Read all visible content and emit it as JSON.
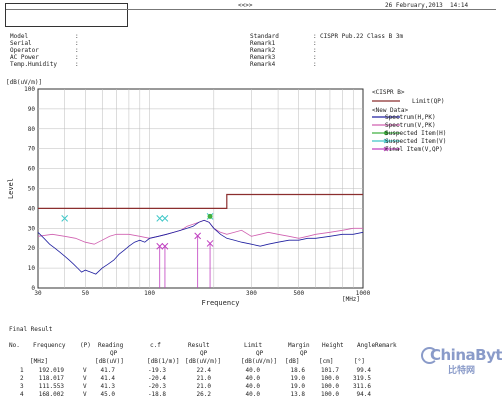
{
  "header": {
    "nav": "<<>>",
    "date": "26 February,2013  14:14",
    "left_fields": [
      {
        "label": "Model",
        "sep": ":",
        "value": ""
      },
      {
        "label": "Serial",
        "sep": ":",
        "value": ""
      },
      {
        "label": "Operator",
        "sep": ":",
        "value": ""
      },
      {
        "label": "AC Power",
        "sep": ":",
        "value": ""
      },
      {
        "label": "Temp.Humidity",
        "sep": ":",
        "value": ""
      }
    ],
    "right_fields": [
      {
        "label": "Standard",
        "sep": ":",
        "value": "CISPR Pub.22 Class B 3m"
      },
      {
        "label": "Remark1",
        "sep": ":",
        "value": ""
      },
      {
        "label": "Remark2",
        "sep": ":",
        "value": ""
      },
      {
        "label": "Remark3",
        "sep": ":",
        "value": ""
      },
      {
        "label": "Remark4",
        "sep": ":",
        "value": ""
      }
    ]
  },
  "chart_data": {
    "type": "line",
    "ylabel_unit": "[dB(uV/m)]",
    "ylabel": "Level",
    "xlabel": "Frequency",
    "xunit": "[MHz]",
    "xscale": "log",
    "xlim": [
      30,
      1000
    ],
    "ylim": [
      0,
      100
    ],
    "yticks": [
      0,
      10,
      20,
      30,
      40,
      50,
      60,
      70,
      80,
      90,
      100
    ],
    "xticks": [
      {
        "value": 30,
        "label": "30"
      },
      {
        "value": 50,
        "label": "50"
      },
      {
        "value": 100,
        "label": "100"
      },
      {
        "value": 300,
        "label": "300"
      },
      {
        "value": 500,
        "label": "500"
      },
      {
        "value": 1000,
        "label": "1000"
      }
    ],
    "grid": true,
    "limit_line": {
      "x": [
        30,
        230,
        230,
        1000
      ],
      "y": [
        40,
        40,
        47,
        47
      ],
      "color": "#8b2e2e"
    },
    "spectrum_h": {
      "color": "#2020a0",
      "x": [
        30,
        32,
        34,
        36,
        38,
        40,
        42,
        44,
        46,
        48,
        50,
        53,
        56,
        60,
        64,
        68,
        72,
        76,
        80,
        85,
        90,
        95,
        100,
        110,
        120,
        130,
        140,
        150,
        160,
        170,
        180,
        190,
        200,
        215,
        230,
        250,
        270,
        300,
        330,
        360,
        400,
        450,
        500,
        550,
        600,
        700,
        800,
        900,
        1000
      ],
      "y": [
        28,
        25,
        22,
        20,
        18,
        16,
        14,
        12,
        10,
        8,
        9,
        8,
        7,
        10,
        12,
        14,
        17,
        19,
        21,
        23,
        24,
        23,
        25,
        26,
        27,
        28,
        29,
        30,
        31,
        33,
        34,
        33,
        30,
        27,
        25,
        24,
        23,
        22,
        21,
        22,
        23,
        24,
        24,
        25,
        25,
        26,
        27,
        27,
        28
      ]
    },
    "spectrum_v": {
      "color": "#d060b0",
      "x": [
        30,
        35,
        40,
        45,
        50,
        55,
        60,
        65,
        70,
        80,
        90,
        100,
        110,
        120,
        130,
        140,
        150,
        160,
        170,
        180,
        190,
        200,
        215,
        230,
        250,
        270,
        300,
        330,
        360,
        400,
        450,
        500,
        550,
        600,
        700,
        800,
        900,
        1000
      ],
      "y": [
        26,
        27,
        26,
        25,
        23,
        22,
        24,
        26,
        27,
        27,
        26,
        25,
        26,
        27,
        28,
        29,
        31,
        32,
        33,
        34,
        33,
        30,
        28,
        27,
        28,
        29,
        26,
        27,
        28,
        27,
        26,
        25,
        26,
        27,
        28,
        29,
        30,
        30
      ]
    },
    "suspected_h": {
      "color": "#40b040",
      "x": [
        192.019
      ],
      "y": [
        36
      ]
    },
    "suspected_v": {
      "color": "#40c8c8",
      "x": [
        40,
        111.553,
        118.017,
        192.019
      ],
      "y": [
        35,
        35,
        35,
        36
      ]
    },
    "final_v": {
      "color": "#c040c0",
      "x": [
        111.553,
        118.017,
        168.002,
        192.019
      ],
      "y": [
        21.0,
        21.0,
        26.2,
        22.4
      ]
    },
    "legend": {
      "position": "right",
      "title": "<CISPR B>",
      "subtitle": "<New Data>",
      "items": [
        {
          "label": "Limit(QP)",
          "color": "#8b2e2e",
          "marker": "none"
        },
        {
          "label": "Spectrum(H,PK)",
          "color": "#2020a0",
          "marker": "none"
        },
        {
          "label": "Spectrum(V,PK)",
          "color": "#d060b0",
          "marker": "none"
        },
        {
          "label": "Suspected Item(H)",
          "color": "#40b040",
          "marker": "circle"
        },
        {
          "label": "Suspected Item(V)",
          "color": "#40c8c8",
          "marker": "x"
        },
        {
          "label": "Final Item(V,QP)",
          "color": "#c040c0",
          "marker": "x"
        }
      ]
    }
  },
  "results": {
    "title": "Final Result",
    "columns": [
      {
        "h1": "No.",
        "h2": "",
        "h3": ""
      },
      {
        "h1": "Frequency",
        "h2": "",
        "h3": "[MHz]"
      },
      {
        "h1": "(P)",
        "h2": "",
        "h3": ""
      },
      {
        "h1": "Reading",
        "h2": "QP",
        "h3": "[dB(uV)]"
      },
      {
        "h1": "c.f",
        "h2": "",
        "h3": "[dB(1/m)]"
      },
      {
        "h1": "Result",
        "h2": "QP",
        "h3": "[dB(uV/m)]"
      },
      {
        "h1": "Limit",
        "h2": "QP",
        "h3": "[dB(uV/m)]"
      },
      {
        "h1": "Margin",
        "h2": "QP",
        "h3": "[dB]"
      },
      {
        "h1": "Height",
        "h2": "",
        "h3": "[cm]"
      },
      {
        "h1": "Angle",
        "h2": "",
        "h3": "[°]"
      },
      {
        "h1": "Remark",
        "h2": "",
        "h3": ""
      }
    ],
    "rows": [
      [
        "1",
        "192.019",
        "V",
        "41.7",
        "-19.3",
        "22.4",
        "40.0",
        "18.6",
        "101.7",
        "99.4",
        ""
      ],
      [
        "2",
        "118.017",
        "V",
        "41.4",
        "-20.4",
        "21.0",
        "40.0",
        "19.0",
        "100.0",
        "319.5",
        ""
      ],
      [
        "3",
        "111.553",
        "V",
        "41.3",
        "-20.3",
        "21.0",
        "40.0",
        "19.0",
        "100.0",
        "311.6",
        ""
      ],
      [
        "4",
        "168.002",
        "V",
        "45.0",
        "-18.8",
        "26.2",
        "40.0",
        "13.8",
        "100.0",
        "94.4",
        ""
      ]
    ]
  },
  "watermark": {
    "line1": "ChinaByte",
    "line2": "比特网"
  }
}
